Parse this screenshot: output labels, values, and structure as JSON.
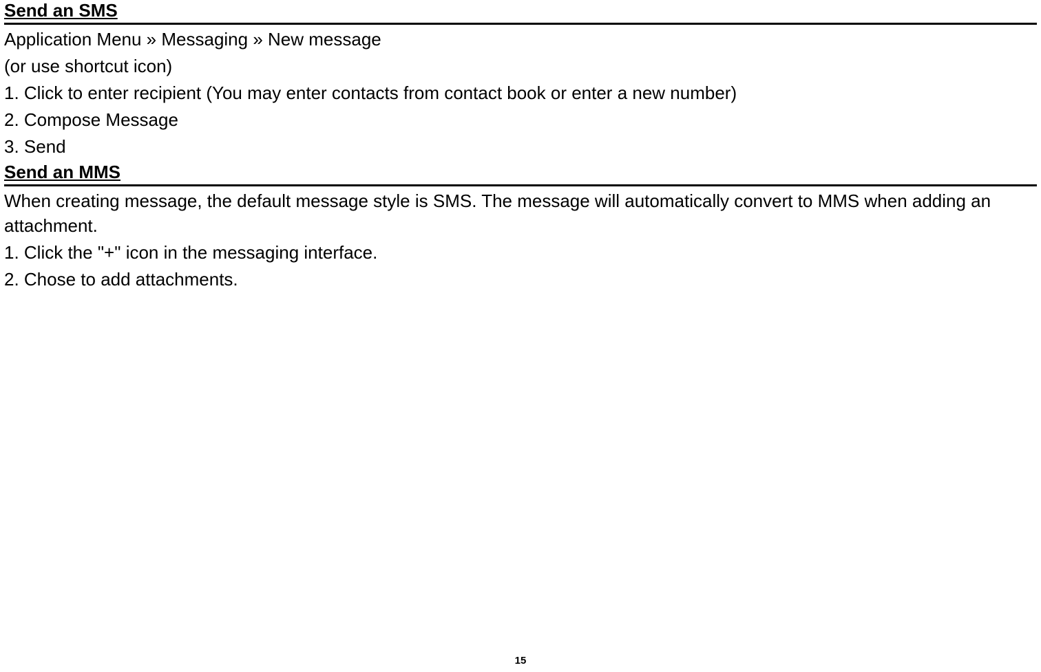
{
  "section1": {
    "heading": "Send an SMS",
    "breadcrumb": "Application Menu » Messaging » New message",
    "shortcut": "(or use shortcut icon)",
    "steps": [
      "1. Click to enter recipient (You may enter contacts from contact book or enter a new number)",
      "2. Compose Message",
      "3. Send"
    ]
  },
  "section2": {
    "heading": "Send an MMS",
    "intro": "When creating message, the default message style is SMS. The message will automatically convert to MMS when adding an attachment.",
    "steps": [
      "1. Click the \"+\" icon in the messaging interface.",
      "2. Chose to add attachments."
    ]
  },
  "pageNumber": "15"
}
